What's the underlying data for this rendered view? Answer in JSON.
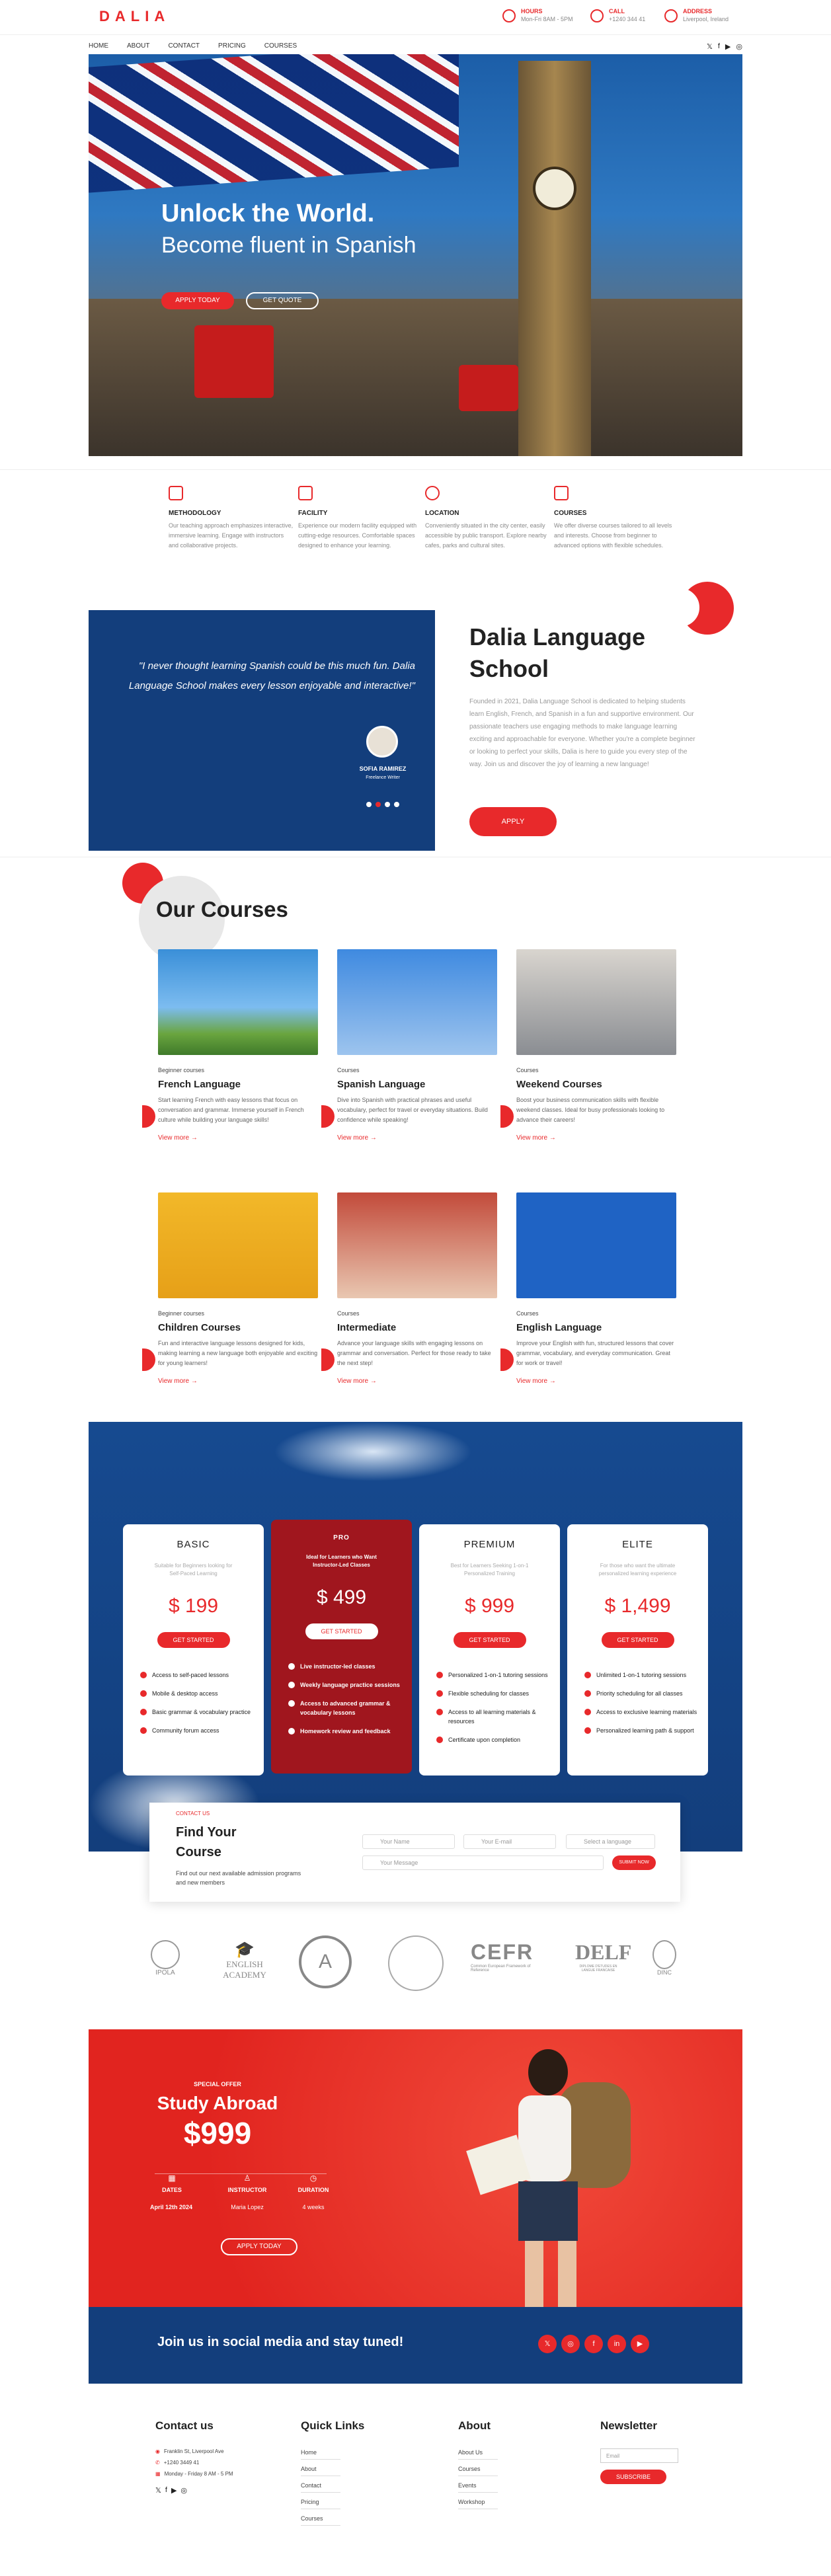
{
  "header": {
    "logo": "DALIA",
    "hours_title": "HOURS",
    "hours_value": "Mon-Fri 8AM - 5PM",
    "call_title": "CALL",
    "call_value": "+1240 344 41",
    "address_title": "ADDRESS",
    "address_value": "Liverpool, Ireland"
  },
  "nav": [
    "HOME",
    "ABOUT",
    "CONTACT",
    "PRICING",
    "COURSES"
  ],
  "social_icons": [
    "x-icon",
    "facebook-icon",
    "youtube-icon",
    "instagram-icon"
  ],
  "hero": {
    "title": "Unlock the World.",
    "subtitle": "Become fluent in Spanish",
    "apply": "APPLY TODAY",
    "quote": "GET QUOTE"
  },
  "features": [
    {
      "title": "METHODOLOGY",
      "text": "Our teaching approach emphasizes interactive, immersive learning. Engage with instructors and collaborative projects."
    },
    {
      "title": "FACILITY",
      "text": "Experience our modern facility equipped with cutting-edge resources. Comfortable spaces designed to enhance your learning."
    },
    {
      "title": "LOCATION",
      "text": "Conveniently situated in the city center, easily accessible by public transport. Explore nearby cafes, parks and cultural sites."
    },
    {
      "title": "COURSES",
      "text": "We offer diverse courses tailored to all levels and interests. Choose from beginner to advanced options with flexible schedules."
    }
  ],
  "testimonial": {
    "quote": "\"I never thought learning Spanish could be this much fun. Dalia Language School makes every lesson enjoyable and interactive!\"",
    "name": "SOFIA RAMIREZ",
    "role": "Freelance Writer"
  },
  "about": {
    "title_line1": "Dalia Language",
    "title_line2": "School",
    "text": "Founded in 2021, Dalia Language School is dedicated to helping students learn English, French, and Spanish in a fun and supportive environment. Our passionate teachers use engaging methods to make language learning exciting and approachable for everyone. Whether you're a complete beginner or looking to perfect your skills, Dalia is here to guide you every step of the way. Join us and discover the joy of learning a new language!",
    "button": "APPLY"
  },
  "courses_title": "Our Courses",
  "courses": [
    {
      "cat": "Beginner courses",
      "title": "French Language",
      "text": "Start learning French with easy lessons that focus on conversation and grammar. Immerse yourself in French culture while building your language skills!",
      "more": "View more"
    },
    {
      "cat": "Courses",
      "title": "Spanish Language",
      "text": "Dive into Spanish with practical phrases and useful vocabulary, perfect for travel or everyday situations. Build confidence while speaking!",
      "more": "View more"
    },
    {
      "cat": "Courses",
      "title": "Weekend Courses",
      "text": "Boost your business communication skills with flexible weekend classes. Ideal for busy professionals looking to advance their careers!",
      "more": "View more"
    },
    {
      "cat": "Beginner courses",
      "title": "Children Courses",
      "text": "Fun and interactive language lessons designed for kids, making learning a new language both enjoyable and exciting for young learners!",
      "more": "View more"
    },
    {
      "cat": "Courses",
      "title": "Intermediate",
      "text": "Advance your language skills with engaging lessons on grammar and conversation. Perfect for those ready to take the next step!",
      "more": "View more"
    },
    {
      "cat": "Courses",
      "title": "English Language",
      "text": "Improve your English with fun, structured lessons that cover grammar, vocabulary, and everyday communication. Great for work or travel!",
      "more": "View more"
    }
  ],
  "pricing": [
    {
      "name": "BASIC",
      "sub": "Suitable for Beginners looking for Self-Paced Learning",
      "price": "$ 199",
      "btn": "GET STARTED",
      "items": [
        "Access to self-paced lessons",
        "Mobile & desktop access",
        "Basic grammar & vocabulary practice",
        "Community forum access"
      ]
    },
    {
      "name": "PRO",
      "sub": "Ideal for Learners who Want Instructor-Led Classes",
      "price": "$ 499",
      "btn": "GET STARTED",
      "items": [
        "Live instructor-led classes",
        "Weekly language practice sessions",
        "Access to advanced grammar & vocabulary lessons",
        "Homework review and feedback"
      ]
    },
    {
      "name": "PREMIUM",
      "sub": "Best for Learners Seeking 1-on-1 Personalized Training",
      "price": "$ 999",
      "btn": "GET STARTED",
      "items": [
        "Personalized 1-on-1 tutoring sessions",
        "Flexible scheduling for classes",
        "Access to all learning materials & resources",
        "Certificate upon completion"
      ]
    },
    {
      "name": "ELITE",
      "sub": "For those who want the ultimate personalized learning experience",
      "price": "$ 1,499",
      "btn": "GET STARTED",
      "items": [
        "Unlimited 1-on-1 tutoring sessions",
        "Priority scheduling for all classes",
        "Access to exclusive learning materials",
        "Personalized learning path & support"
      ]
    }
  ],
  "contact": {
    "label": "CONTACT US",
    "title1": "Find Your",
    "title2": "Course",
    "text": "Find out our next available admission programs and new members",
    "name_ph": "Your Name",
    "email_ph": "Your E-mail",
    "lang_ph": "Select a language",
    "msg_ph": "Your Message",
    "button": "SUBMIT NOW"
  },
  "logos": [
    "IPOLA",
    "ENGLISH ACADEMY",
    "A",
    "CEFR",
    "DELF",
    "DINC"
  ],
  "logo_small": {
    "cefr": "Common European Framework of Reference",
    "delf": "DIPLOME D'ETUDES EN LANGUE FRANCAISE"
  },
  "offer": {
    "label": "SPECIAL OFFER",
    "title": "Study Abroad",
    "price": "$999",
    "dates_label": "DATES",
    "dates": "April 12th 2024",
    "instructor_label": "INSTRUCTOR",
    "instructor": "Maria Lopez",
    "duration_label": "DURATION",
    "duration": "4 weeks",
    "button": "APPLY TODAY"
  },
  "social_band": {
    "title": "Join us in social media and stay tuned!",
    "icons": [
      "x-icon",
      "instagram-icon",
      "facebook-icon",
      "linkedin-icon",
      "youtube-icon"
    ]
  },
  "footer": {
    "contact_title": "Contact us",
    "address": "Franklin St, Liverpool Ave",
    "phone": "+1240 3449 41",
    "hours": "Monday - Friday 8 AM - 5 PM",
    "quick_title": "Quick Links",
    "quick": [
      "Home",
      "About",
      "Contact",
      "Pricing",
      "Courses"
    ],
    "about_title": "About",
    "about_links": [
      "About Us",
      "Courses",
      "Events",
      "Workshop"
    ],
    "news_title": "Newsletter",
    "email_ph": "Email",
    "subscribe": "SUBSCRIBE"
  }
}
